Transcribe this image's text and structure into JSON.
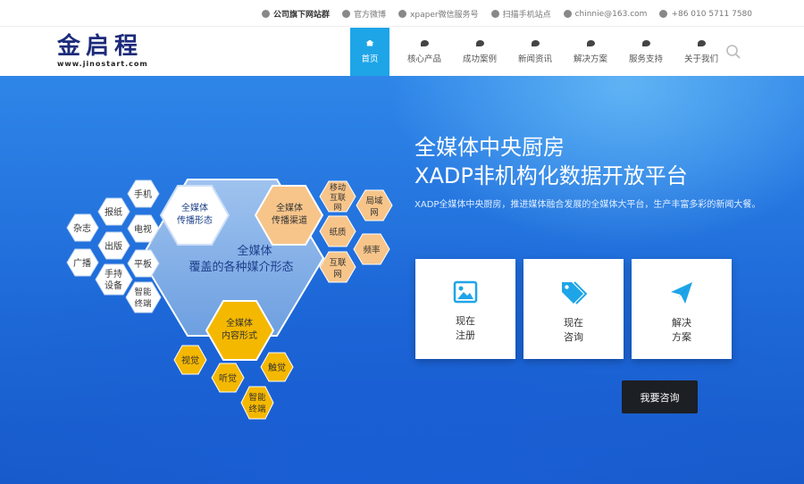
{
  "topbar": {
    "items": [
      {
        "icon": "phone-icon",
        "label": "公司旗下网站群"
      },
      {
        "icon": "weibo-icon",
        "label": "官方微博"
      },
      {
        "icon": "wechat-icon",
        "label": "xpaper微信服务号"
      },
      {
        "icon": "mobile-icon",
        "label": "扫描手机站点"
      },
      {
        "icon": "mail-icon",
        "label": "chinnie@163.com"
      },
      {
        "icon": "phone-icon",
        "label": "+86 010 5711 7580"
      }
    ]
  },
  "logo": {
    "text": "金启程",
    "url": "www.jinostart.com"
  },
  "nav": {
    "items": [
      {
        "label": "首页",
        "icon": "home-icon",
        "active": true
      },
      {
        "label": "核心产品",
        "icon": "leaf-icon"
      },
      {
        "label": "成功案例",
        "icon": "chat-icon"
      },
      {
        "label": "新闻资讯",
        "icon": "chat-icon"
      },
      {
        "label": "解决方案",
        "icon": "chat-icon"
      },
      {
        "label": "服务支持",
        "icon": "chat-icon"
      },
      {
        "label": "关于我们",
        "icon": "chat-icon"
      }
    ]
  },
  "hero": {
    "title_line1": "全媒体中央厨房",
    "title_line2": "XADP非机构化数据开放平台",
    "description": "XADP全媒体中央厨房，推进媒体融合发展的全媒体大平台，生产丰富多彩的新闻大餐。",
    "cards": [
      {
        "icon": "image-icon",
        "label": "现在注册"
      },
      {
        "icon": "tag-icon",
        "label": "现在咨询"
      },
      {
        "icon": "send-icon",
        "label": "解决方案"
      }
    ],
    "consult_button": "我要咨询"
  },
  "diagram": {
    "center": "全媒体覆盖的各种媒介形态",
    "spread_form": "全媒体传播形态",
    "spread_channel": "全媒体传播渠道",
    "content_form": "全媒体内容形式",
    "left_items": [
      "手机",
      "报纸",
      "杂志",
      "电视",
      "出版",
      "广播",
      "平板",
      "手持设备",
      "智能终端"
    ],
    "right_items": [
      "移动互联网",
      "局域网",
      "纸质",
      "频率",
      "互联网"
    ],
    "bottom_items": [
      "视觉",
      "听觉",
      "触觉",
      "智能终端"
    ]
  },
  "colors": {
    "accent": "#1ea5e8",
    "hero_blue": "#1e6ad9",
    "hex_orange": "#f7c58a",
    "hex_yellow": "#f5b800"
  }
}
